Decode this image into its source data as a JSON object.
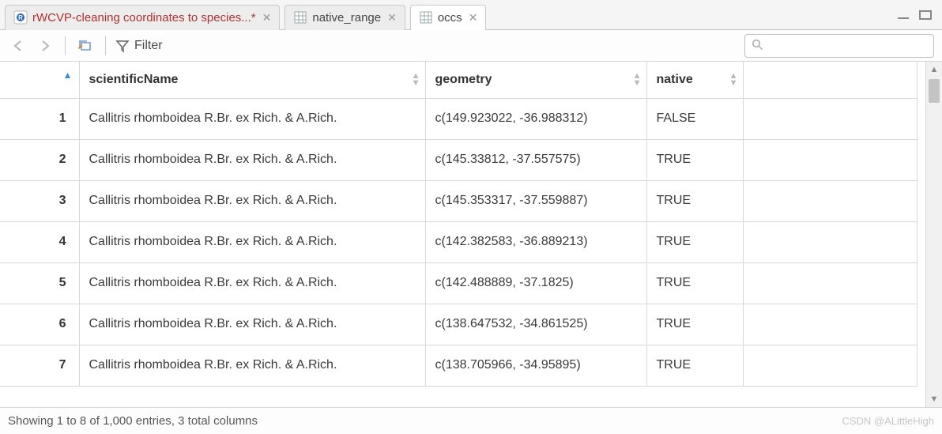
{
  "tabs": [
    {
      "label": "rWCVP-cleaning coordinates to species...*",
      "kind": "script"
    },
    {
      "label": "native_range",
      "kind": "data"
    },
    {
      "label": "occs",
      "kind": "data"
    }
  ],
  "active_tab_index": 2,
  "toolbar": {
    "filter_label": "Filter",
    "search_placeholder": ""
  },
  "columns": [
    "scientificName",
    "geometry",
    "native"
  ],
  "rows": [
    {
      "n": "1",
      "scientificName": "Callitris rhomboidea R.Br. ex Rich. & A.Rich.",
      "geometry": "c(149.923022, -36.988312)",
      "native": "FALSE"
    },
    {
      "n": "2",
      "scientificName": "Callitris rhomboidea R.Br. ex Rich. & A.Rich.",
      "geometry": "c(145.33812, -37.557575)",
      "native": "TRUE"
    },
    {
      "n": "3",
      "scientificName": "Callitris rhomboidea R.Br. ex Rich. & A.Rich.",
      "geometry": "c(145.353317, -37.559887)",
      "native": "TRUE"
    },
    {
      "n": "4",
      "scientificName": "Callitris rhomboidea R.Br. ex Rich. & A.Rich.",
      "geometry": "c(142.382583, -36.889213)",
      "native": "TRUE"
    },
    {
      "n": "5",
      "scientificName": "Callitris rhomboidea R.Br. ex Rich. & A.Rich.",
      "geometry": "c(142.488889, -37.1825)",
      "native": "TRUE"
    },
    {
      "n": "6",
      "scientificName": "Callitris rhomboidea R.Br. ex Rich. & A.Rich.",
      "geometry": "c(138.647532, -34.861525)",
      "native": "TRUE"
    },
    {
      "n": "7",
      "scientificName": "Callitris rhomboidea R.Br. ex Rich. & A.Rich.",
      "geometry": "c(138.705966, -34.95895)",
      "native": "TRUE"
    }
  ],
  "status_text": "Showing 1 to 8 of 1,000 entries, 3 total columns",
  "watermark": "CSDN @ALittleHigh"
}
